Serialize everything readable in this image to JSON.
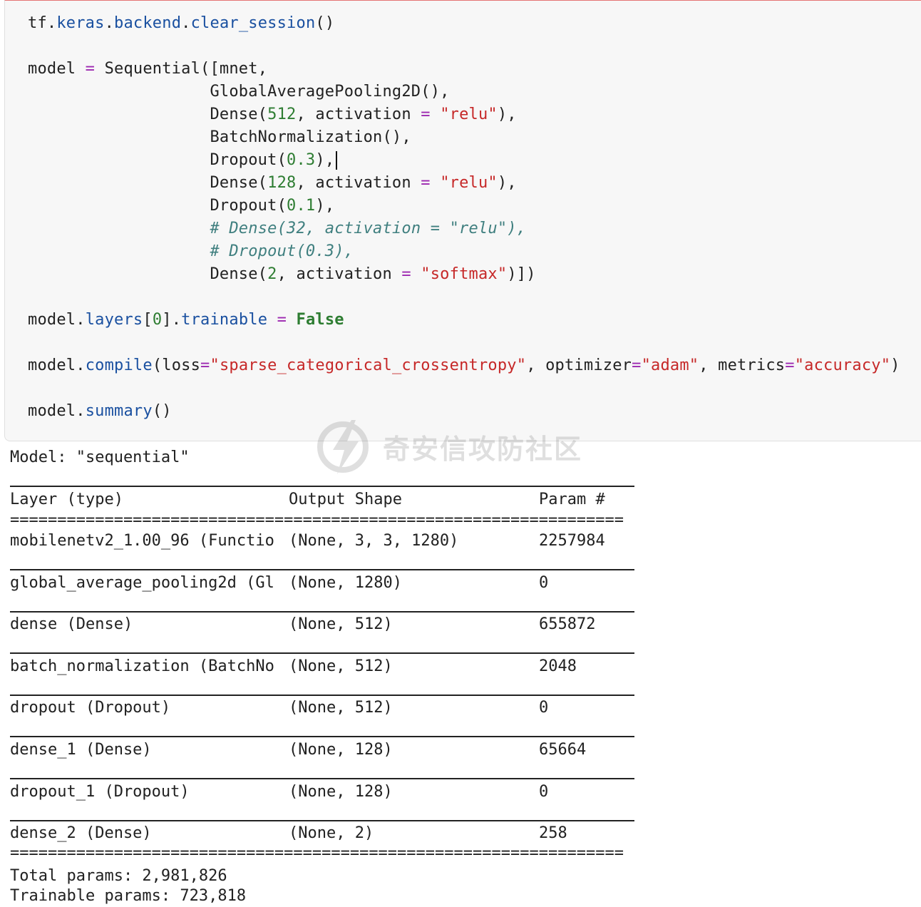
{
  "code_cell": {
    "lines": [
      [
        {
          "t": "tf",
          "c": "def"
        },
        {
          "t": ".",
          "c": "def"
        },
        {
          "t": "keras",
          "c": "attr"
        },
        {
          "t": ".",
          "c": "def"
        },
        {
          "t": "backend",
          "c": "attr"
        },
        {
          "t": ".",
          "c": "def"
        },
        {
          "t": "clear_session",
          "c": "attr"
        },
        {
          "t": "()",
          "c": "def"
        }
      ],
      [],
      [
        {
          "t": "model ",
          "c": "def"
        },
        {
          "t": "=",
          "c": "op"
        },
        {
          "t": " Sequential([mnet,",
          "c": "def"
        }
      ],
      [
        {
          "t": "                   GlobalAveragePooling2D(),",
          "c": "def"
        }
      ],
      [
        {
          "t": "                   Dense(",
          "c": "def"
        },
        {
          "t": "512",
          "c": "num"
        },
        {
          "t": ", activation ",
          "c": "def"
        },
        {
          "t": "=",
          "c": "op"
        },
        {
          "t": " ",
          "c": "def"
        },
        {
          "t": "\"relu\"",
          "c": "str"
        },
        {
          "t": "),",
          "c": "def"
        }
      ],
      [
        {
          "t": "                   BatchNormalization(),",
          "c": "def"
        }
      ],
      [
        {
          "t": "                   Dropout(",
          "c": "def"
        },
        {
          "t": "0.3",
          "c": "num"
        },
        {
          "t": "),",
          "c": "def"
        },
        {
          "t": "",
          "c": "cursor"
        }
      ],
      [
        {
          "t": "                   Dense(",
          "c": "def"
        },
        {
          "t": "128",
          "c": "num"
        },
        {
          "t": ", activation ",
          "c": "def"
        },
        {
          "t": "=",
          "c": "op"
        },
        {
          "t": " ",
          "c": "def"
        },
        {
          "t": "\"relu\"",
          "c": "str"
        },
        {
          "t": "),",
          "c": "def"
        }
      ],
      [
        {
          "t": "                   Dropout(",
          "c": "def"
        },
        {
          "t": "0.1",
          "c": "num"
        },
        {
          "t": "),",
          "c": "def"
        }
      ],
      [
        {
          "t": "                   ",
          "c": "def"
        },
        {
          "t": "# Dense(32, activation = \"relu\"),",
          "c": "com"
        }
      ],
      [
        {
          "t": "                   ",
          "c": "def"
        },
        {
          "t": "# Dropout(0.3),",
          "c": "com"
        }
      ],
      [
        {
          "t": "                   Dense(",
          "c": "def"
        },
        {
          "t": "2",
          "c": "num"
        },
        {
          "t": ", activation ",
          "c": "def"
        },
        {
          "t": "=",
          "c": "op"
        },
        {
          "t": " ",
          "c": "def"
        },
        {
          "t": "\"softmax\"",
          "c": "str"
        },
        {
          "t": ")])",
          "c": "def"
        }
      ],
      [],
      [
        {
          "t": "model",
          "c": "def"
        },
        {
          "t": ".",
          "c": "def"
        },
        {
          "t": "layers",
          "c": "attr"
        },
        {
          "t": "[",
          "c": "def"
        },
        {
          "t": "0",
          "c": "num"
        },
        {
          "t": "].",
          "c": "def"
        },
        {
          "t": "trainable",
          "c": "attr"
        },
        {
          "t": " ",
          "c": "def"
        },
        {
          "t": "=",
          "c": "op"
        },
        {
          "t": " ",
          "c": "def"
        },
        {
          "t": "False",
          "c": "kw"
        }
      ],
      [],
      [
        {
          "t": "model",
          "c": "def"
        },
        {
          "t": ".",
          "c": "def"
        },
        {
          "t": "compile",
          "c": "attr"
        },
        {
          "t": "(loss",
          "c": "def"
        },
        {
          "t": "=",
          "c": "op"
        },
        {
          "t": "\"sparse_categorical_crossentropy\"",
          "c": "str"
        },
        {
          "t": ", optimizer",
          "c": "def"
        },
        {
          "t": "=",
          "c": "op"
        },
        {
          "t": "\"adam\"",
          "c": "str"
        },
        {
          "t": ", metrics",
          "c": "def"
        },
        {
          "t": "=",
          "c": "op"
        },
        {
          "t": "\"accuracy\"",
          "c": "str"
        },
        {
          "t": ")",
          "c": "def"
        }
      ],
      [],
      [
        {
          "t": "model",
          "c": "def"
        },
        {
          "t": ".",
          "c": "def"
        },
        {
          "t": "summary",
          "c": "attr"
        },
        {
          "t": "()",
          "c": "def"
        }
      ]
    ]
  },
  "watermark": {
    "text": "奇安信攻防社区"
  },
  "output": {
    "model_title": "Model: \"sequential\"",
    "headers": {
      "layer": "Layer (type)",
      "shape": "Output Shape",
      "param": "Param #"
    },
    "eq_rule": "=================================================================",
    "rows": [
      {
        "layer": "mobilenetv2_1.00_96 (Functio",
        "shape": "(None, 3, 3, 1280)",
        "param": "2257984"
      },
      {
        "layer": "global_average_pooling2d (Gl",
        "shape": "(None, 1280)",
        "param": "0"
      },
      {
        "layer": "dense (Dense)",
        "shape": "(None, 512)",
        "param": "655872"
      },
      {
        "layer": "batch_normalization (BatchNo",
        "shape": "(None, 512)",
        "param": "2048"
      },
      {
        "layer": "dropout (Dropout)",
        "shape": "(None, 512)",
        "param": "0"
      },
      {
        "layer": "dense_1 (Dense)",
        "shape": "(None, 128)",
        "param": "65664"
      },
      {
        "layer": "dropout_1 (Dropout)",
        "shape": "(None, 128)",
        "param": "0"
      },
      {
        "layer": "dense_2 (Dense)",
        "shape": "(None, 2)",
        "param": "258"
      }
    ],
    "total_params": "Total params: 2,981,826",
    "trainable_params": "Trainable params: 723,818"
  }
}
